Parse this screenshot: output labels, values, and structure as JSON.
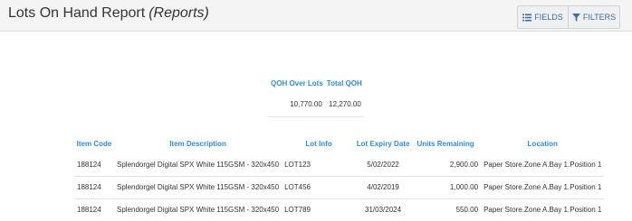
{
  "header": {
    "title": "Lots On Hand Report",
    "subtitle": "(Reports)",
    "fields_label": "FIELDS",
    "filters_label": "FILTERS"
  },
  "summary": {
    "headers": [
      "QOH Over Lots",
      "Total QOH"
    ],
    "values": [
      "10,770.00",
      "12,270.00"
    ]
  },
  "lots": {
    "headers": [
      "Item Code",
      "Item Description",
      "Lot Info",
      "Lot Expiry Date",
      "Units Remaining",
      "Location"
    ],
    "rows": [
      [
        "188124",
        "Splendorgel Digital SPX White 115GSM - 320x450",
        "LOT123",
        "5/02/2022",
        "2,900.00",
        "Paper Store.Zone A.Bay 1.Position 1"
      ],
      [
        "188124",
        "Splendorgel Digital SPX White 115GSM - 320x450",
        "LOT456",
        "4/02/2019",
        "1,000.00",
        "Paper Store.Zone A.Bay 1.Position 1"
      ],
      [
        "188124",
        "Splendorgel Digital SPX White 115GSM - 320x450",
        "LOT789",
        "31/03/2024",
        "550.00",
        "Paper Store.Zone A.Bay 1.Position 1"
      ]
    ]
  }
}
